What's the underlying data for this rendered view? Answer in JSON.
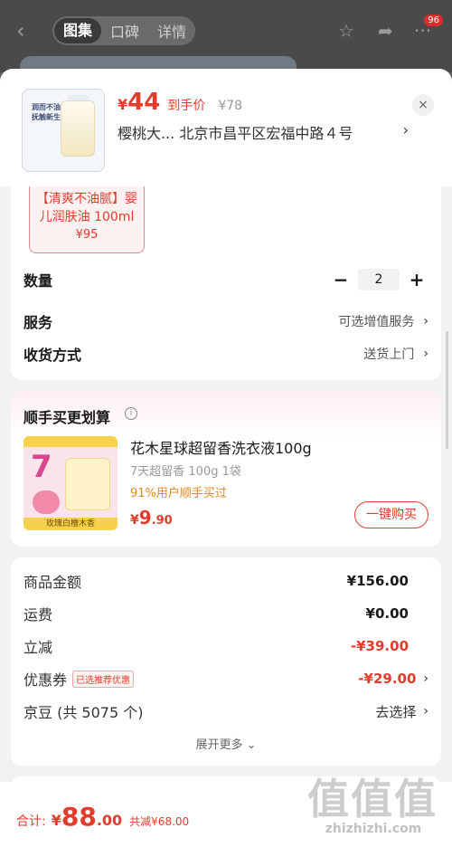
{
  "background_page": {
    "tabs": [
      "图集",
      "口碑",
      "详情"
    ],
    "active_tab": "图集",
    "badge": "96",
    "back_icon": "chevron-left-icon",
    "icons": [
      "star-icon",
      "share-icon",
      "more-icon"
    ]
  },
  "header": {
    "thumbnail_text": "润而不油 抚触新生",
    "price_symbol": "¥",
    "price": "44",
    "price_tag": "到手价",
    "original_price": "¥78",
    "address": "樱桃大...  北京市昌平区宏福中路４号",
    "address_chevron": "›",
    "close_icon": "×"
  },
  "variant": {
    "name": "【清爽不油腻】婴儿润肤油 100ml",
    "price": "¥95"
  },
  "options": {
    "quantity_label": "数量",
    "quantity_minus": "−",
    "quantity_value": "2",
    "quantity_plus": "+",
    "service_label": "服务",
    "service_value": "可选增值服务",
    "delivery_label": "收货方式",
    "delivery_value": "送货上门"
  },
  "addon": {
    "title": "顺手买更划算",
    "info_icon": "i",
    "product_name": "花木星球超留香洗衣液100g",
    "product_spec": "7天超留香 100g 1袋",
    "bought_text": "91%用户顺手买过",
    "price_symbol": "¥",
    "price_int": "9",
    "price_dec": ".90",
    "buy_button": "一键购买",
    "image_number": "7",
    "image_caption": "玫瑰白檀木香"
  },
  "summary": {
    "rows": [
      {
        "label": "商品金额",
        "value": "¥156.00"
      },
      {
        "label": "运费",
        "value": "¥0.00"
      },
      {
        "label": "立减",
        "value": "-¥39.00"
      },
      {
        "label": "优惠券",
        "value": "-¥29.00"
      },
      {
        "label": "京豆 (共 5075 个)",
        "value": "去选择"
      }
    ],
    "coupon_tag": "已选推荐优惠",
    "expand_more": "展开更多 ⌄"
  },
  "footer": {
    "total_label": "合计:",
    "total_symbol": "¥",
    "total_int": "88",
    "total_dec": ".00",
    "total_saved": "共减¥68.00"
  },
  "watermark": {
    "glyphs": "值值值",
    "url": "zhizhizhi.com"
  },
  "colors": {
    "accent_red": "#e23c2c",
    "bought_orange": "#e2891e"
  }
}
